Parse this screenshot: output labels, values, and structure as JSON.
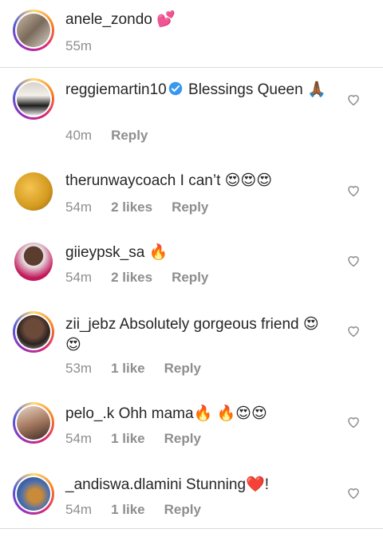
{
  "comments": [
    {
      "username": "anele_zondo",
      "body": "💕",
      "time": "55m",
      "likes": "",
      "reply": "",
      "verified": false
    },
    {
      "username": "reggiemartin10",
      "body": "Blessings Queen 🙏🏾",
      "time": "40m",
      "likes": "",
      "reply": "Reply",
      "verified": true
    },
    {
      "username": "therunwaycoach",
      "body": "I can’t 😍😍😍",
      "time": "54m",
      "likes": "2 likes",
      "reply": "Reply",
      "verified": false
    },
    {
      "username": "giieypsk_sa",
      "body": "🔥",
      "time": "54m",
      "likes": "2 likes",
      "reply": "Reply",
      "verified": false
    },
    {
      "username": "zii_jebz",
      "body": "Absolutely gorgeous friend 😍😍",
      "time": "53m",
      "likes": "1 like",
      "reply": "Reply",
      "verified": false
    },
    {
      "username": "pelo_.k",
      "body": "Ohh mama🔥 🔥😍😍",
      "time": "54m",
      "likes": "1 like",
      "reply": "Reply",
      "verified": false
    },
    {
      "username": "_andiswa.dlamini",
      "body": "Stunning❤️!",
      "time": "54m",
      "likes": "1 like",
      "reply": "Reply",
      "verified": false
    }
  ],
  "colors": {
    "verified": "#3897f0",
    "meta": "#8e8e8e",
    "text": "#262626"
  }
}
